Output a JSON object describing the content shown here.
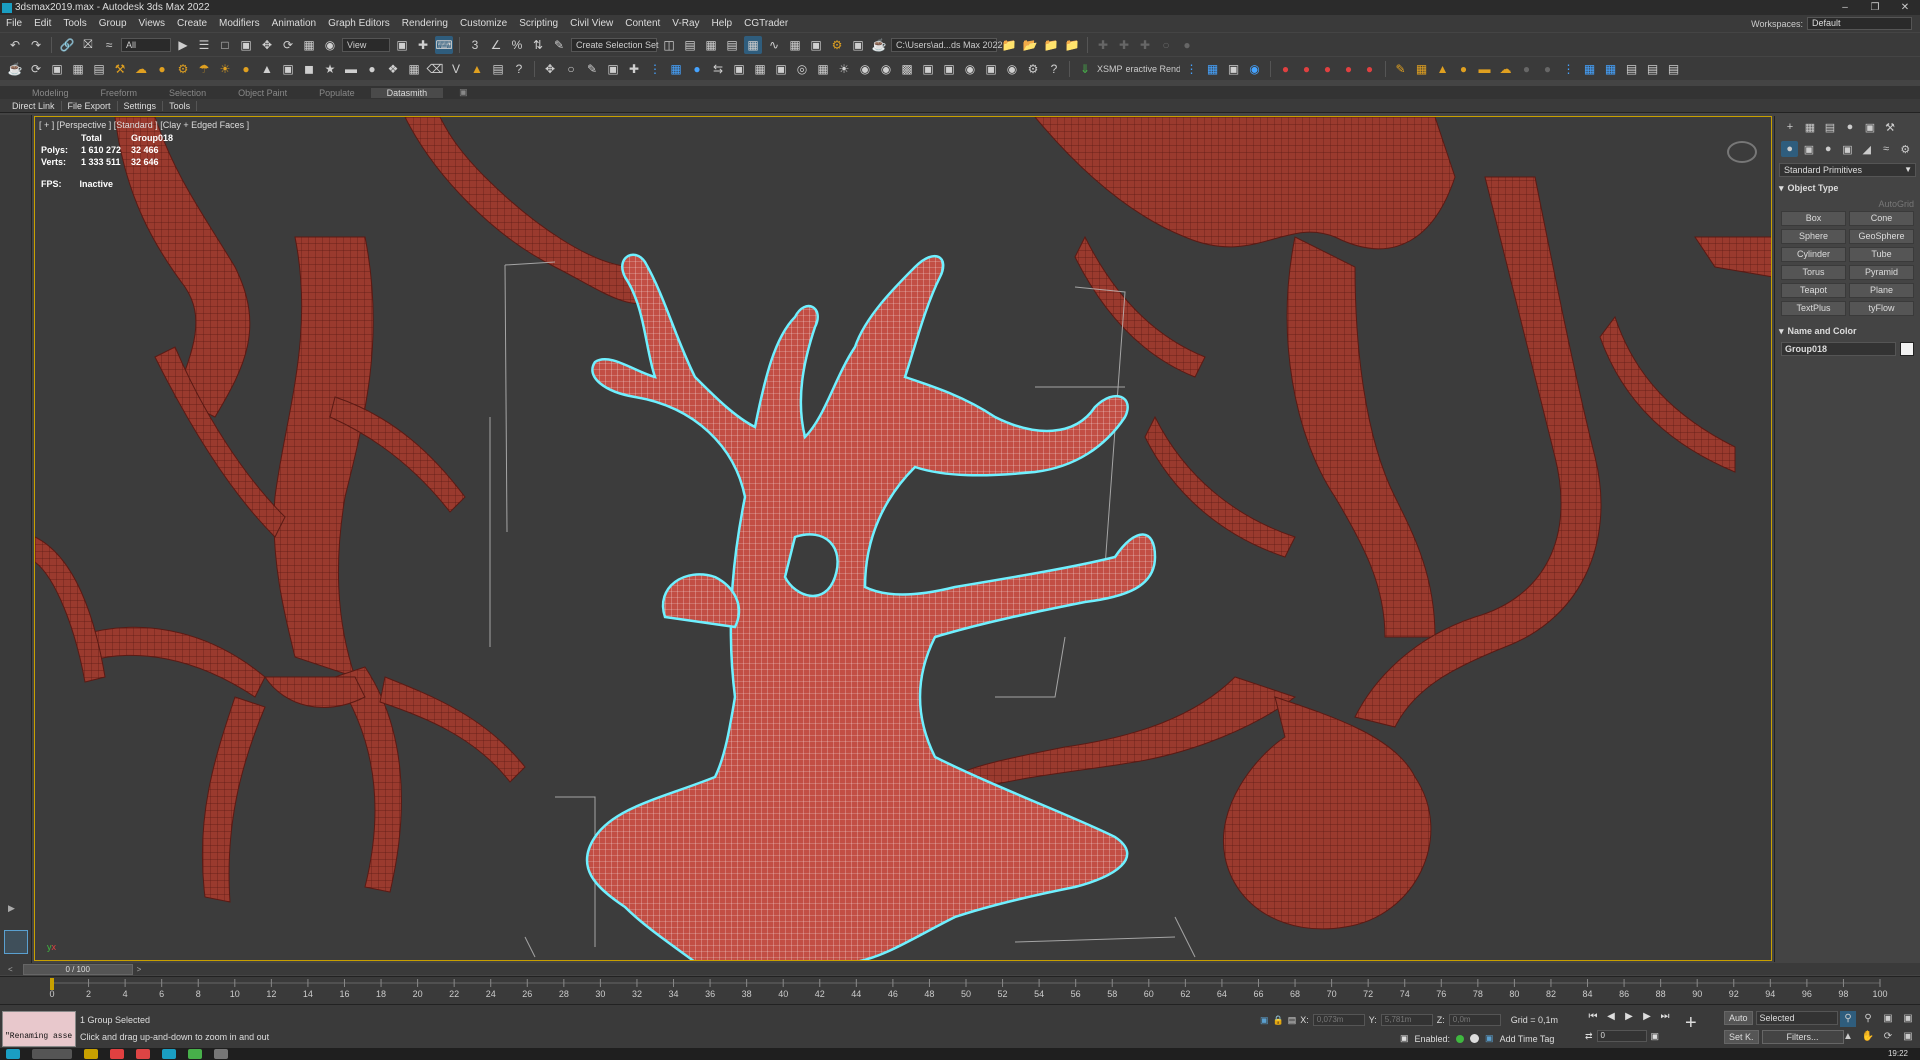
{
  "window": {
    "title": "3dsmax2019.max - Autodesk 3ds Max 2022"
  },
  "menu": {
    "items": [
      "File",
      "Edit",
      "Tools",
      "Group",
      "Views",
      "Create",
      "Modifiers",
      "Animation",
      "Graph Editors",
      "Rendering",
      "Customize",
      "Scripting",
      "Civil View",
      "Content",
      "V-Ray",
      "Help",
      "CGTrader"
    ],
    "workspace_label": "Workspaces:",
    "workspace_value": "Default"
  },
  "main_toolbar": {
    "filter_select": "All",
    "ref_coord_select": "View",
    "selection_set": "Create Selection Set",
    "project_path": "C:\\Users\\ad...ds Max 2022"
  },
  "toolbar2": {
    "xsmp_label": "XSMP",
    "renderer_label": "eractive Renderi"
  },
  "ribbon": {
    "tabs": [
      "Modeling",
      "Freeform",
      "Selection",
      "Object Paint",
      "Populate",
      "Datasmith"
    ],
    "active_tab": "Datasmith",
    "sub_items": [
      "Direct Link",
      "File Export",
      "Settings",
      "Tools"
    ]
  },
  "viewport": {
    "label": "[ + ] [Perspective ] [Standard ] [Clay + Edged Faces ]",
    "stats": {
      "header_total": "Total",
      "header_object": "Group018",
      "polys_label": "Polys:",
      "polys_total": "1 610 272",
      "polys_object": "32 466",
      "verts_label": "Verts:",
      "verts_total": "1 333 511",
      "verts_object": "32 646"
    },
    "fps_label": "FPS:",
    "fps_value": "Inactive"
  },
  "command_panel": {
    "category_select": "Standard Primitives",
    "object_type_title": "Object Type",
    "autogrid_label": "AutoGrid",
    "primitives": [
      "Box",
      "Cone",
      "Sphere",
      "GeoSphere",
      "Cylinder",
      "Tube",
      "Torus",
      "Pyramid",
      "Teapot",
      "Plane",
      "TextPlus",
      "tyFlow"
    ],
    "name_color_title": "Name and Color",
    "object_name": "Group018"
  },
  "timeline": {
    "frame_display": "0 / 100",
    "ticks": [
      "0",
      "2",
      "4",
      "6",
      "8",
      "10",
      "12",
      "14",
      "16",
      "18",
      "20",
      "22",
      "24",
      "26",
      "28",
      "30",
      "32",
      "34",
      "36",
      "38",
      "40",
      "42",
      "44",
      "46",
      "48",
      "50",
      "52",
      "54",
      "56",
      "58",
      "60",
      "62",
      "64",
      "66",
      "68",
      "70",
      "72",
      "74",
      "76",
      "78",
      "80",
      "82",
      "84",
      "86",
      "88",
      "90",
      "92",
      "94",
      "96",
      "98",
      "100"
    ]
  },
  "status": {
    "maxscript_text": "\"Renaming asse",
    "selection_text": "1 Group Selected",
    "prompt_text": "Click and drag up-and-down to zoom in and out",
    "x_label": "X:",
    "x_value": "0,073m",
    "y_label": "Y:",
    "y_value": "5,781m",
    "z_label": "Z:",
    "z_value": "0,0m",
    "grid_text": "Grid = 0,1m",
    "enabled_label": "Enabled:",
    "add_time_tag": "Add Time Tag",
    "auto_label": "Auto",
    "selected_select": "Selected",
    "setk_label": "Set K.",
    "filters_label": "Filters...",
    "frame_field": "0",
    "clock": "19:22"
  }
}
